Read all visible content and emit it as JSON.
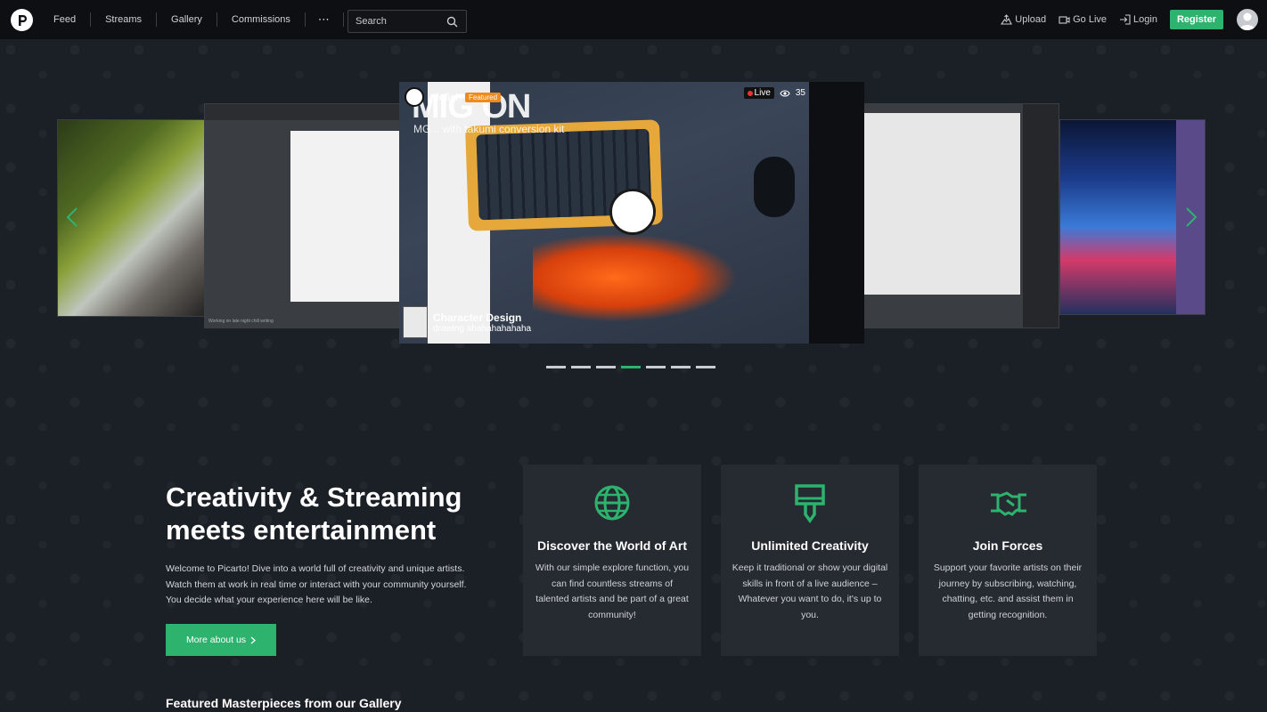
{
  "header": {
    "logo_icon": "picarto-logo-icon",
    "nav": [
      {
        "label": "Feed"
      },
      {
        "label": "Streams"
      },
      {
        "label": "Gallery"
      },
      {
        "label": "Commissions"
      }
    ],
    "more_label": "⋯",
    "search": {
      "placeholder": "Search",
      "value": ""
    },
    "actions": {
      "upload": "Upload",
      "go_live": "Go Live",
      "login": "Login",
      "register": "Register"
    }
  },
  "carousel": {
    "featured": {
      "overlay_title": "MIG ON",
      "overlay_subtitle": "MG... with takumi conversion kit",
      "streamer": "...lefish",
      "featured_label": "Featured",
      "live_label": "Live",
      "viewers": "35",
      "category": "Character Design",
      "stream_title": "drawing ahahahahahaha"
    },
    "side_caption": "Working on late night chill writing",
    "dots": 7,
    "active_dot": 4
  },
  "hero": {
    "title_line1": "Creativity & Streaming",
    "title_line2": "meets entertainment",
    "description": "Welcome to Picarto! Dive into a world full of creativity and unique artists. Watch them at work in real time or interact with your community yourself. You decide what your experience here will be like.",
    "button": "More about us"
  },
  "features": [
    {
      "icon": "globe-icon",
      "title": "Discover the World of Art",
      "text": "With our simple explore function, you can find countless streams of talented artists and be part of a great community!"
    },
    {
      "icon": "brush-icon",
      "title": "Unlimited Creativity",
      "text": "Keep it traditional or show your digital skills in front of a live audience – Whatever you want to do, it's up to you."
    },
    {
      "icon": "handshake-icon",
      "title": "Join Forces",
      "text": "Support your favorite artists on their journey by subscribing, watching, chatting, etc. and assist them in getting recognition."
    }
  ],
  "gallery_heading": "Featured Masterpieces from our Gallery",
  "colors": {
    "accent": "#2db36d",
    "background": "#1b1f26",
    "header": "#0d0f12",
    "featured": "#f08a1a",
    "live": "#e53535"
  }
}
